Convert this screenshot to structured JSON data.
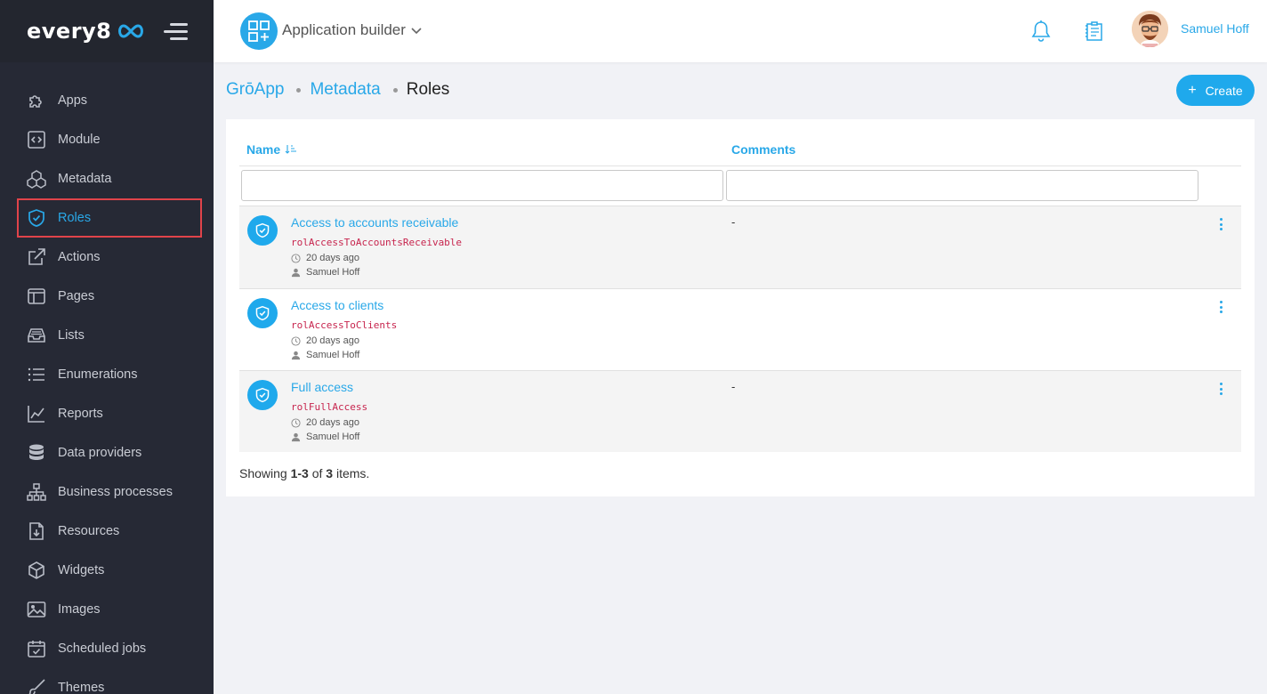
{
  "brand": {
    "name": "every8"
  },
  "sidebar": {
    "items": [
      {
        "label": "Apps",
        "icon": "puzzle-icon"
      },
      {
        "label": "Module",
        "icon": "code-icon"
      },
      {
        "label": "Metadata",
        "icon": "cubes-icon"
      },
      {
        "label": "Roles",
        "icon": "shield-icon",
        "active": true
      },
      {
        "label": "Actions",
        "icon": "external-link-icon"
      },
      {
        "label": "Pages",
        "icon": "layout-icon"
      },
      {
        "label": "Lists",
        "icon": "inbox-icon"
      },
      {
        "label": "Enumerations",
        "icon": "list-icon"
      },
      {
        "label": "Reports",
        "icon": "line-chart-icon"
      },
      {
        "label": "Data providers",
        "icon": "database-icon"
      },
      {
        "label": "Business processes",
        "icon": "sitemap-icon"
      },
      {
        "label": "Resources",
        "icon": "file-download-icon"
      },
      {
        "label": "Widgets",
        "icon": "cube-icon"
      },
      {
        "label": "Images",
        "icon": "image-icon"
      },
      {
        "label": "Scheduled jobs",
        "icon": "calendar-check-icon"
      },
      {
        "label": "Themes",
        "icon": "brush-icon"
      }
    ]
  },
  "header": {
    "app_title": "Application builder",
    "user_name": "Samuel Hoff"
  },
  "breadcrumb": {
    "items": [
      "GrōApp",
      "Metadata"
    ],
    "current": "Roles"
  },
  "toolbar": {
    "create_label": "Create",
    "create_icon": "+"
  },
  "table": {
    "columns": {
      "name": "Name",
      "comments": "Comments"
    },
    "rows": [
      {
        "title": "Access to accounts receivable",
        "code": "rolAccessToAccountsReceivable",
        "time": "20 days ago",
        "user": "Samuel Hoff",
        "comment": "-"
      },
      {
        "title": "Access to clients",
        "code": "rolAccessToClients",
        "time": "20 days ago",
        "user": "Samuel Hoff",
        "comment": ""
      },
      {
        "title": "Full access",
        "code": "rolFullAccess",
        "time": "20 days ago",
        "user": "Samuel Hoff",
        "comment": "-"
      }
    ]
  },
  "summary": {
    "prefix": "Showing ",
    "range": "1-3",
    "middle": " of ",
    "total": "3",
    "suffix": " items."
  },
  "colors": {
    "accent": "#29a8e8",
    "sidebar_bg": "#262935",
    "code": "#c7254e",
    "highlight": "#e0434a"
  }
}
